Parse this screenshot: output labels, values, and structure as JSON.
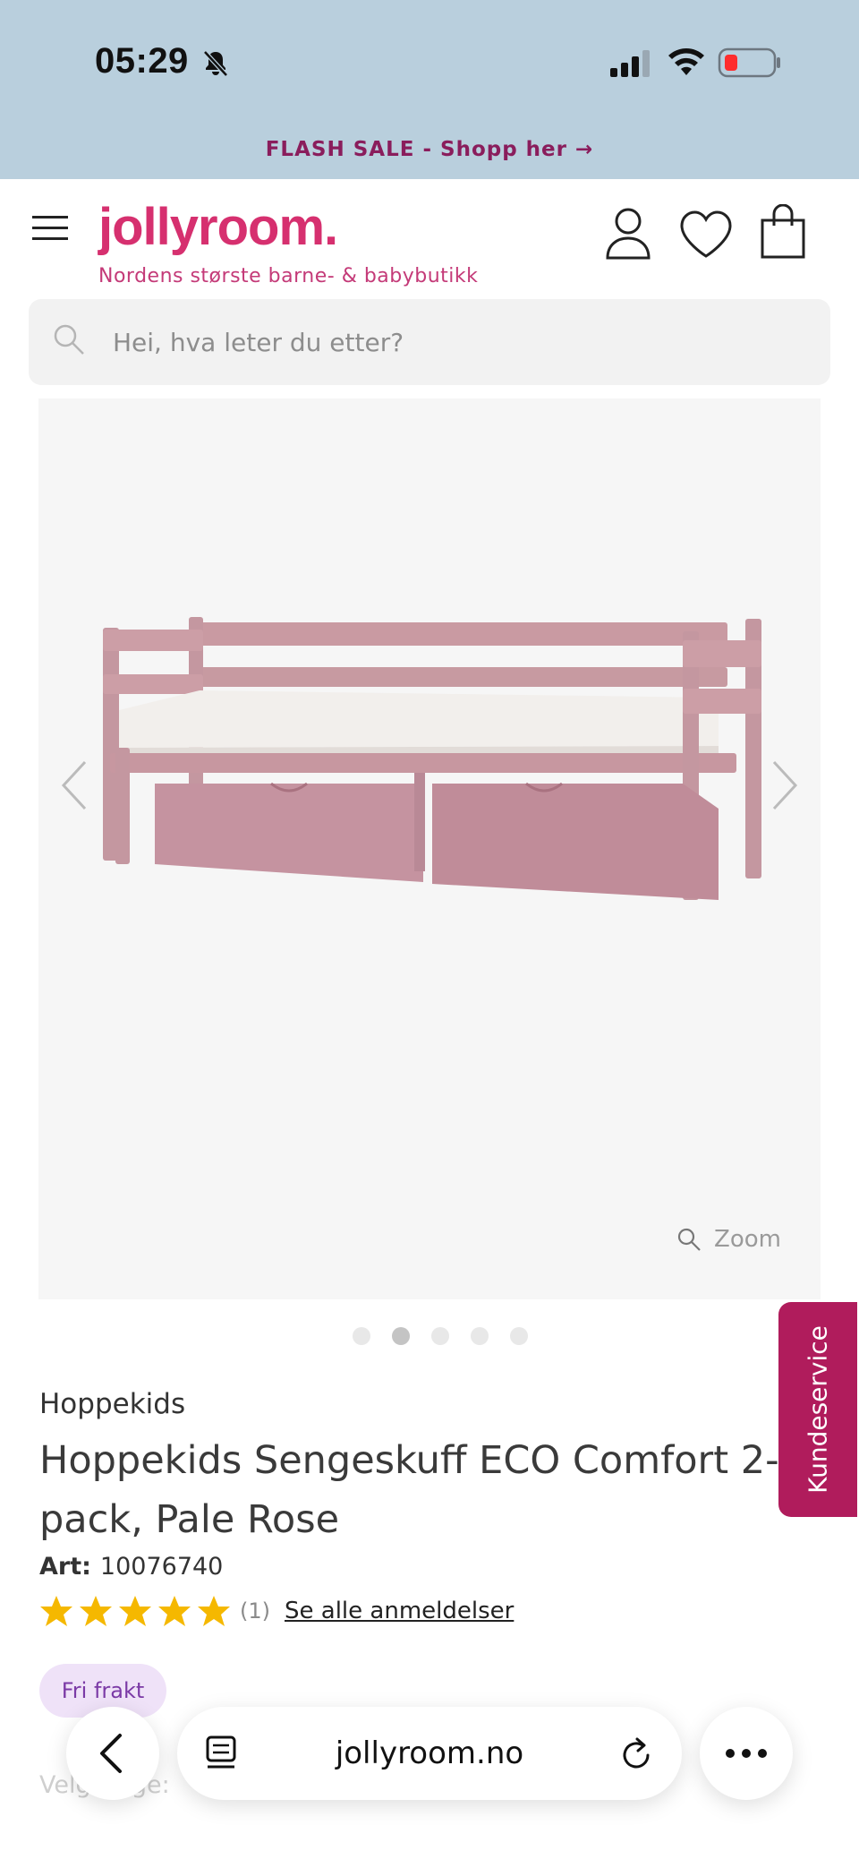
{
  "status_bar": {
    "time": "05:29"
  },
  "promo": {
    "text": "FLASH SALE - Shopp her →"
  },
  "header": {
    "logo": "jollyroom.",
    "tagline": "Nordens største barne- & babybutikk"
  },
  "search": {
    "placeholder": "Hei, hva leter du etter?"
  },
  "gallery": {
    "zoom_label": "Zoom",
    "image_count": 5,
    "active_index": 1
  },
  "product": {
    "brand": "Hoppekids",
    "title_line1": "Hoppekids Sengeskuff ECO Comfort 2-",
    "title_line2": "pack, Pale Rose",
    "art_label": "Art:",
    "art_number": "10076740",
    "rating_stars": 5,
    "rating_count": "(1)",
    "reviews_link": "Se alle anmeldelser",
    "badge": "Fri frakt",
    "select_label": "Velg farge:"
  },
  "side_tab": {
    "label": "Kundeservice"
  },
  "browser": {
    "url": "jollyroom.no"
  },
  "colors": {
    "brand_pink": "#d6306f",
    "promo_text": "#8a1d5c",
    "side_tab": "#b01c5c",
    "badge_bg": "#efe2f8",
    "star": "#f5b800"
  }
}
